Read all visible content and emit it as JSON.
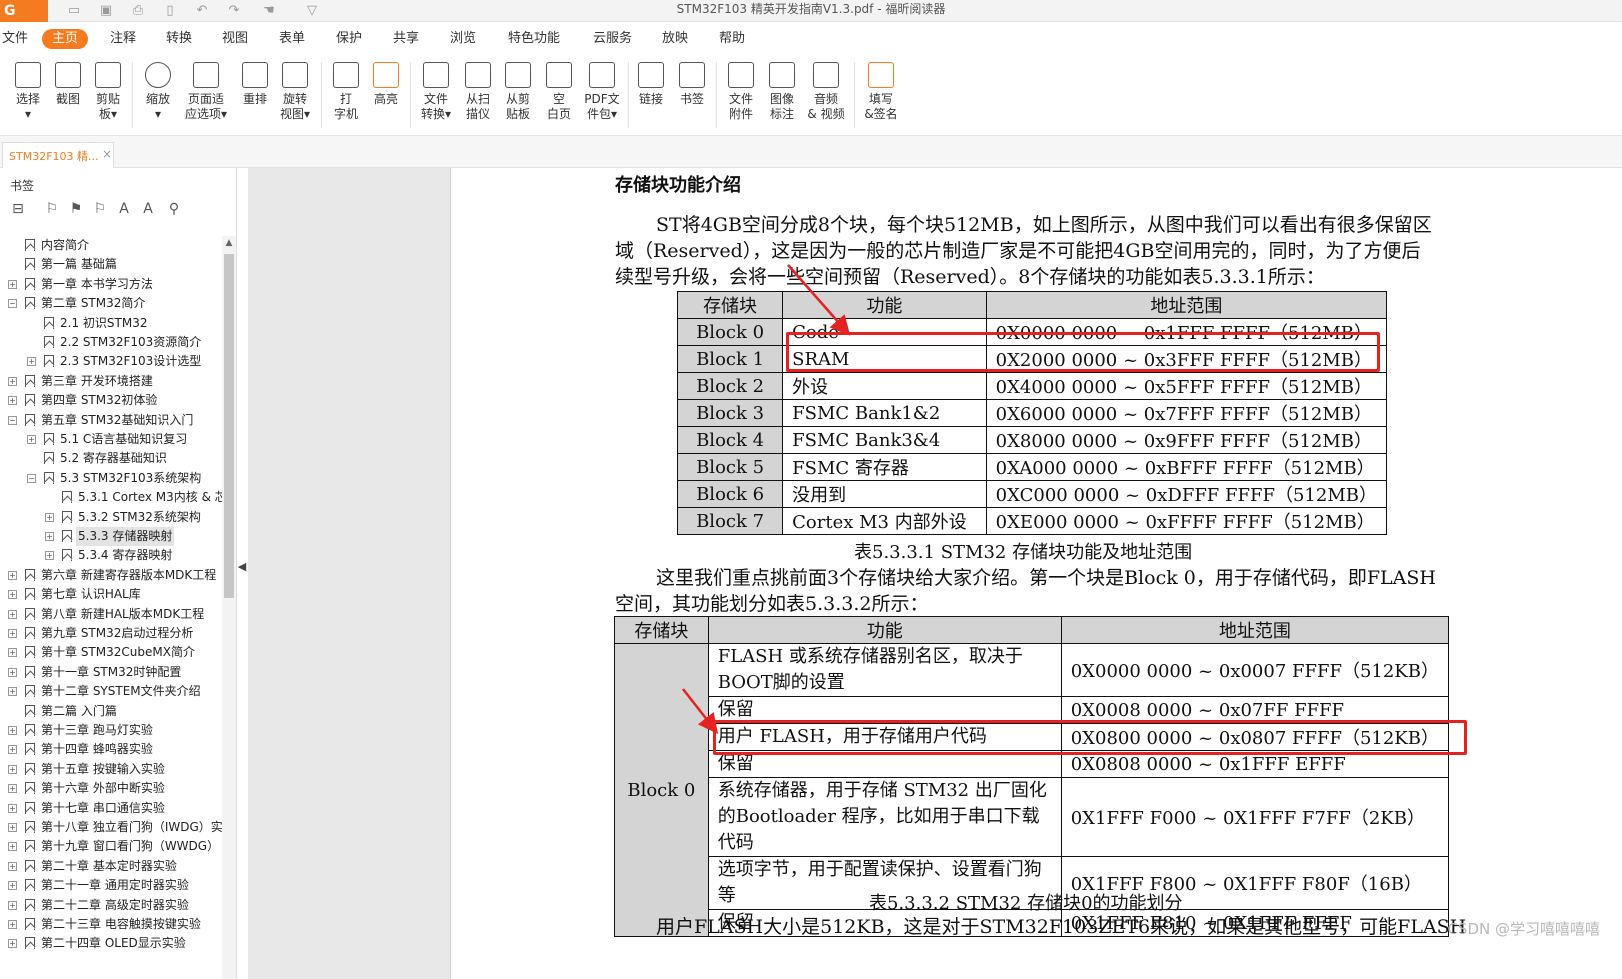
{
  "titlebar": {
    "app_logo": "G",
    "window_title": "STM32F103 精英开发指南V1.3.pdf - 福昕阅读器"
  },
  "menu": {
    "file_label": "文件",
    "tabs": [
      "主页",
      "注释",
      "转换",
      "视图",
      "表单",
      "保护",
      "共享",
      "浏览",
      "特色功能",
      "云服务",
      "放映",
      "帮助"
    ],
    "active_tab": "主页"
  },
  "ribbon": {
    "buttons": [
      {
        "label": "选择\n▾",
        "icon": "cursor-icon"
      },
      {
        "label": "截图",
        "icon": "screenshot-icon"
      },
      {
        "label": "剪贴\n板▾",
        "icon": "clipboard-icon"
      },
      {
        "label": "缩放\n▾",
        "icon": "zoom-icon"
      },
      {
        "label": "页面适\n应选项▾",
        "icon": "fit-page-icon"
      },
      {
        "label": "重排",
        "icon": "reflow-icon"
      },
      {
        "label": "旋转\n视图▾",
        "icon": "rotate-view-icon"
      },
      {
        "label": "打\n字机",
        "icon": "typewriter-icon"
      },
      {
        "label": "高亮",
        "icon": "highlight-icon"
      },
      {
        "label": "文件\n转换▾",
        "icon": "file-convert-icon"
      },
      {
        "label": "从扫\n描仪",
        "icon": "scanner-icon"
      },
      {
        "label": "从剪\n贴板",
        "icon": "from-clipboard-icon"
      },
      {
        "label": "空\n白页",
        "icon": "blank-page-icon"
      },
      {
        "label": "PDF文\n件包▾",
        "icon": "pdf-package-icon"
      },
      {
        "label": "链接",
        "icon": "link-icon"
      },
      {
        "label": "书签",
        "icon": "bookmark-icon"
      },
      {
        "label": "文件\n附件",
        "icon": "attachment-icon"
      },
      {
        "label": "图像\n标注",
        "icon": "image-annotation-icon"
      },
      {
        "label": "音频\n& 视频",
        "icon": "audio-video-icon"
      },
      {
        "label": "填写\n&签名",
        "icon": "fill-sign-icon"
      }
    ]
  },
  "doc_tab": {
    "label": "STM32F103 精...",
    "close": "×"
  },
  "sidebar": {
    "title": "书签",
    "bookmarks": [
      {
        "label": "内容简介",
        "level": 0,
        "toggle": ""
      },
      {
        "label": "第一篇 基础篇",
        "level": 0,
        "toggle": ""
      },
      {
        "label": "第一章 本书学习方法",
        "level": 0,
        "toggle": "+"
      },
      {
        "label": "第二章 STM32简介",
        "level": 0,
        "toggle": "−"
      },
      {
        "label": "2.1 初识STM32",
        "level": 1,
        "toggle": ""
      },
      {
        "label": "2.2 STM32F103资源简介",
        "level": 1,
        "toggle": ""
      },
      {
        "label": "2.3 STM32F103设计选型",
        "level": 1,
        "toggle": "+"
      },
      {
        "label": "第三章 开发环境搭建",
        "level": 0,
        "toggle": "+"
      },
      {
        "label": "第四章 STM32初体验",
        "level": 0,
        "toggle": "+"
      },
      {
        "label": "第五章 STM32基础知识入门",
        "level": 0,
        "toggle": "−"
      },
      {
        "label": "5.1 C语言基础知识复习",
        "level": 1,
        "toggle": "+"
      },
      {
        "label": "5.2 寄存器基础知识",
        "level": 1,
        "toggle": ""
      },
      {
        "label": "5.3 STM32F103系统架构",
        "level": 1,
        "toggle": "−"
      },
      {
        "label": "5.3.1 Cortex M3内核 & 芯片",
        "level": 2,
        "toggle": ""
      },
      {
        "label": "5.3.2 STM32系统架构",
        "level": 2,
        "toggle": "+"
      },
      {
        "label": "5.3.3 存储器映射",
        "level": 2,
        "toggle": "+",
        "selected": true
      },
      {
        "label": "5.3.4 寄存器映射",
        "level": 2,
        "toggle": "+"
      },
      {
        "label": "第六章 新建寄存器版本MDK工程",
        "level": 0,
        "toggle": "+"
      },
      {
        "label": "第七章 认识HAL库",
        "level": 0,
        "toggle": "+"
      },
      {
        "label": "第八章 新建HAL版本MDK工程",
        "level": 0,
        "toggle": "+"
      },
      {
        "label": "第九章 STM32启动过程分析",
        "level": 0,
        "toggle": "+"
      },
      {
        "label": "第十章 STM32CubeMX简介",
        "level": 0,
        "toggle": "+"
      },
      {
        "label": "第十一章 STM32时钟配置",
        "level": 0,
        "toggle": "+"
      },
      {
        "label": "第十二章 SYSTEM文件夹介绍",
        "level": 0,
        "toggle": "+"
      },
      {
        "label": "第二篇 入门篇",
        "level": 0,
        "toggle": ""
      },
      {
        "label": "第十三章 跑马灯实验",
        "level": 0,
        "toggle": "+"
      },
      {
        "label": "第十四章 蜂鸣器实验",
        "level": 0,
        "toggle": "+"
      },
      {
        "label": "第十五章 按键输入实验",
        "level": 0,
        "toggle": "+"
      },
      {
        "label": "第十六章 外部中断实验",
        "level": 0,
        "toggle": "+"
      },
      {
        "label": "第十七章 串口通信实验",
        "level": 0,
        "toggle": "+"
      },
      {
        "label": "第十八章 独立看门狗（IWDG）实",
        "level": 0,
        "toggle": "+"
      },
      {
        "label": "第十九章 窗口看门狗（WWDG）",
        "level": 0,
        "toggle": "+"
      },
      {
        "label": "第二十章 基本定时器实验",
        "level": 0,
        "toggle": "+"
      },
      {
        "label": "第二十一章 通用定时器实验",
        "level": 0,
        "toggle": "+"
      },
      {
        "label": "第二十二章 高级定时器实验",
        "level": 0,
        "toggle": "+"
      },
      {
        "label": "第二十三章 电容触摸按键实验",
        "level": 0,
        "toggle": "+"
      },
      {
        "label": "第二十四章 OLED显示实验",
        "level": 0,
        "toggle": "+"
      }
    ]
  },
  "page": {
    "heading": "存储块功能介绍",
    "para1": [
      "ST将4GB空间分成8个块，每个块512MB，如上图所示，从图中我们可以看出有很多保留区",
      "域（Reserved），这是因为一般的芯片制造厂家是不可能把4GB空间用完的，同时，为了方便后",
      "续型号升级，会将一些空间预留（Reserved）。8个存储块的功能如表5.3.3.1所示："
    ],
    "table1": {
      "headers": [
        "存储块",
        "功能",
        "地址范围"
      ],
      "rows": [
        [
          "Block 0",
          "Code",
          "0X0000 0000 ~ 0x1FFF FFFF（512MB）"
        ],
        [
          "Block 1",
          "SRAM",
          "0X2000 0000 ~ 0x3FFF FFFF（512MB）"
        ],
        [
          "Block 2",
          "外设",
          "0X4000 0000 ~ 0x5FFF FFFF（512MB）"
        ],
        [
          "Block 3",
          "FSMC Bank1&2",
          "0X6000 0000 ~ 0x7FFF FFFF（512MB）"
        ],
        [
          "Block 4",
          "FSMC Bank3&4",
          "0X8000 0000 ~ 0x9FFF FFFF（512MB）"
        ],
        [
          "Block 5",
          "FSMC 寄存器",
          "0XA000 0000 ~ 0xBFFF FFFF（512MB）"
        ],
        [
          "Block 6",
          "没用到",
          "0XC000 0000 ~ 0xDFFF FFFF（512MB）"
        ],
        [
          "Block 7",
          "Cortex M3 内部外设",
          "0XE000 0000 ~ 0xFFFF FFFF（512MB）"
        ]
      ],
      "caption": "表5.3.3.1 STM32  存储块功能及地址范围"
    },
    "para2": [
      "这里我们重点挑前面3个存储块给大家介绍。第一个块是Block 0，用于存储代码，即FLASH",
      "空间，其功能划分如表5.3.3.2所示："
    ],
    "table2": {
      "headers": [
        "存储块",
        "功能",
        "地址范围"
      ],
      "block": "Block 0",
      "rows": [
        [
          "FLASH 或系统存储器别名区，取决于BOOT脚的设置",
          "0X0000 0000 ~ 0x0007 FFFF（512KB）"
        ],
        [
          "保留",
          "0X0008 0000 ~ 0x07FF FFFF"
        ],
        [
          "用户 FLASH，用于存储用户代码",
          "0X0800 0000 ~ 0x0807 FFFF（512KB）"
        ],
        [
          "保留",
          "0X0808 0000 ~ 0x1FFF EFFF"
        ],
        [
          "系统存储器，用于存储 STM32 出厂固化的Bootloader 程序，比如用于串口下载代码",
          "0X1FFF F000 ~ 0X1FFF F7FF（2KB）"
        ],
        [
          "选项字节，用于配置读保护、设置看门狗等",
          "0X1FFF F800 ~ 0X1FFF F80F（16B）"
        ],
        [
          "保留",
          "0X1FFF F810 ~ 0X1FFF FFFF"
        ]
      ],
      "caption": "表5.3.3.2 STM32  存储块0的功能划分"
    },
    "para3": "用户FLASH大小是512KB，这是对于STM32F103ZET6来说，如果是其他型号，可能FLASH",
    "watermark": "CSDN @学习嘻嘻嘻嘻"
  },
  "colors": {
    "accent": "#f47b20",
    "annotation_red": "#e52222",
    "table_header": "#d4d4d4"
  }
}
